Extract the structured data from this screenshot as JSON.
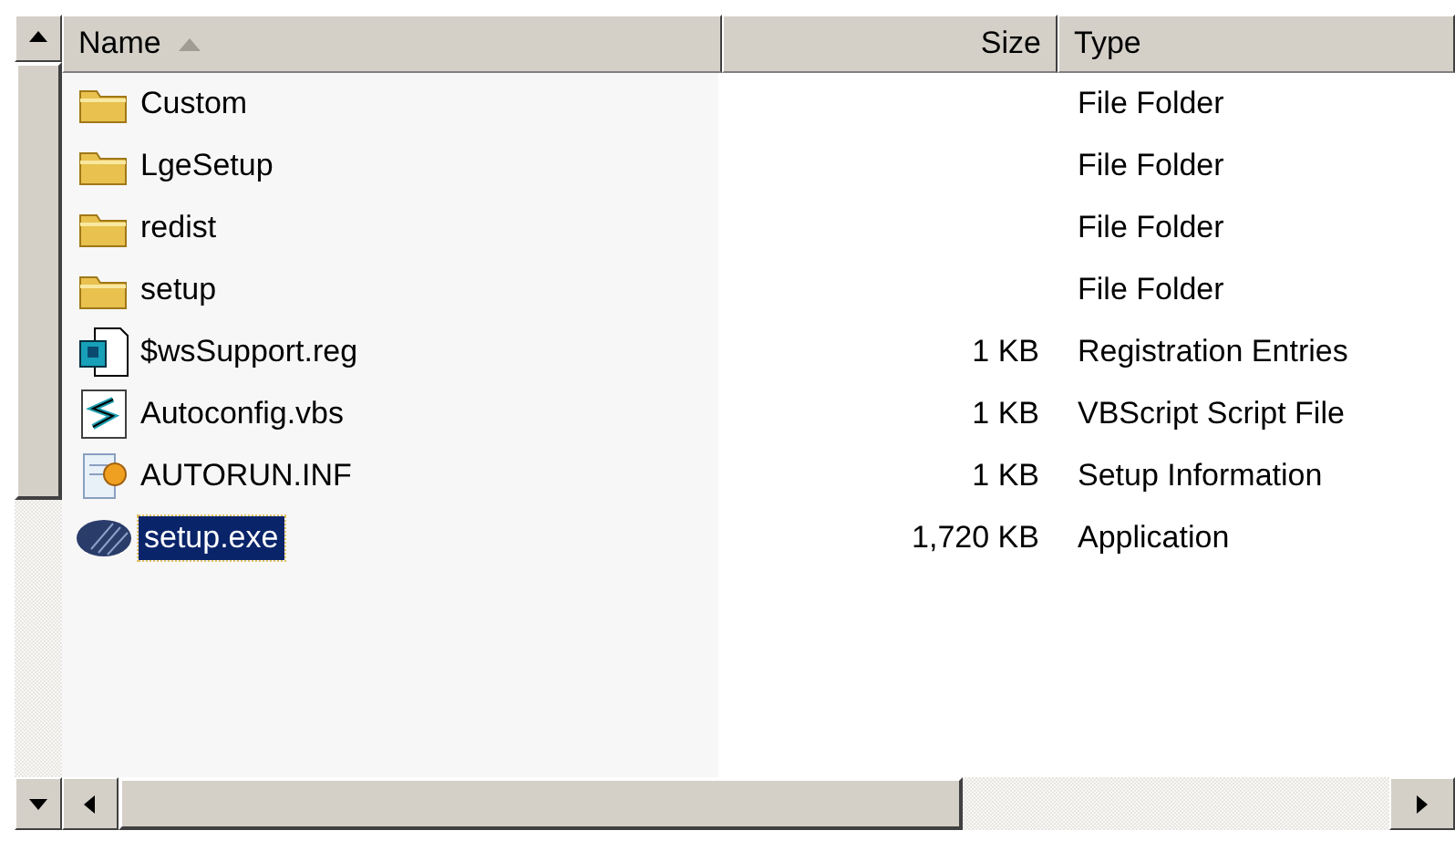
{
  "columns": [
    {
      "label": "Name",
      "sorted": true,
      "kind": "text"
    },
    {
      "label": "Size",
      "sorted": false,
      "kind": "number"
    },
    {
      "label": "Type",
      "sorted": false,
      "kind": "text"
    }
  ],
  "rows": [
    {
      "kind": "folder",
      "name": "Custom",
      "size": "",
      "type": "File Folder",
      "selected": false
    },
    {
      "kind": "folder",
      "name": "LgeSetup",
      "size": "",
      "type": "File Folder",
      "selected": false
    },
    {
      "kind": "folder",
      "name": "redist",
      "size": "",
      "type": "File Folder",
      "selected": false
    },
    {
      "kind": "folder",
      "name": "setup",
      "size": "",
      "type": "File Folder",
      "selected": false
    },
    {
      "kind": "registry",
      "name": "$wsSupport.reg",
      "size": "1 KB",
      "type": "Registration Entries",
      "selected": false
    },
    {
      "kind": "script",
      "name": "Autoconfig.vbs",
      "size": "1 KB",
      "type": "VBScript Script File",
      "selected": false
    },
    {
      "kind": "setup-info",
      "name": "AUTORUN.INF",
      "size": "1 KB",
      "type": "Setup Information",
      "selected": false
    },
    {
      "kind": "application",
      "name": "setup.exe",
      "size": "1,720 KB",
      "type": "Application",
      "selected": true
    }
  ]
}
